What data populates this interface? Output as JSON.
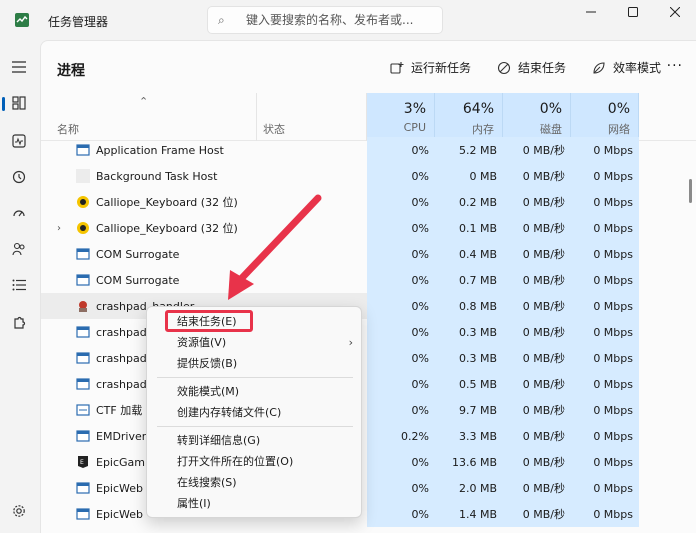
{
  "window": {
    "title": "任务管理器",
    "search_placeholder": "键入要搜索的名称、发布者或..."
  },
  "page": {
    "title": "进程",
    "toolbar": {
      "run_new_task": "运行新任务",
      "end_task": "结束任务",
      "efficiency_mode": "效率模式",
      "more": "···"
    }
  },
  "columns": {
    "name": "名称",
    "status": "状态",
    "cpu": {
      "pct": "3%",
      "label": "CPU"
    },
    "memory": {
      "pct": "64%",
      "label": "内存"
    },
    "disk": {
      "pct": "0%",
      "label": "磁盘"
    },
    "network": {
      "pct": "0%",
      "label": "网络"
    }
  },
  "processes": [
    {
      "name": "Application Frame Host",
      "cpu": "0%",
      "mem": "5.2 MB",
      "disk": "0 MB/秒",
      "net": "0 Mbps"
    },
    {
      "name": "Background Task Host",
      "cpu": "0%",
      "mem": "0 MB",
      "disk": "0 MB/秒",
      "net": "0 Mbps"
    },
    {
      "name": "Calliope_Keyboard (32 位)",
      "cpu": "0%",
      "mem": "0.2 MB",
      "disk": "0 MB/秒",
      "net": "0 Mbps"
    },
    {
      "name": "Calliope_Keyboard (32 位)",
      "cpu": "0%",
      "mem": "0.1 MB",
      "disk": "0 MB/秒",
      "net": "0 Mbps"
    },
    {
      "name": "COM Surrogate",
      "cpu": "0%",
      "mem": "0.4 MB",
      "disk": "0 MB/秒",
      "net": "0 Mbps"
    },
    {
      "name": "COM Surrogate",
      "cpu": "0%",
      "mem": "0.7 MB",
      "disk": "0 MB/秒",
      "net": "0 Mbps"
    },
    {
      "name": "crashpad_handler",
      "cpu": "0%",
      "mem": "0.8 MB",
      "disk": "0 MB/秒",
      "net": "0 Mbps"
    },
    {
      "name": "crashpad",
      "cpu": "0%",
      "mem": "0.3 MB",
      "disk": "0 MB/秒",
      "net": "0 Mbps"
    },
    {
      "name": "crashpad",
      "cpu": "0%",
      "mem": "0.3 MB",
      "disk": "0 MB/秒",
      "net": "0 Mbps"
    },
    {
      "name": "crashpad",
      "cpu": "0%",
      "mem": "0.5 MB",
      "disk": "0 MB/秒",
      "net": "0 Mbps"
    },
    {
      "name": "CTF 加载",
      "cpu": "0%",
      "mem": "9.7 MB",
      "disk": "0 MB/秒",
      "net": "0 Mbps"
    },
    {
      "name": "EMDriver",
      "cpu": "0.2%",
      "mem": "3.3 MB",
      "disk": "0 MB/秒",
      "net": "0 Mbps"
    },
    {
      "name": "EpicGam",
      "cpu": "0%",
      "mem": "13.6 MB",
      "disk": "0 MB/秒",
      "net": "0 Mbps"
    },
    {
      "name": "EpicWeb",
      "cpu": "0%",
      "mem": "2.0 MB",
      "disk": "0 MB/秒",
      "net": "0 Mbps"
    },
    {
      "name": "EpicWeb",
      "cpu": "0%",
      "mem": "1.4 MB",
      "disk": "0 MB/秒",
      "net": "0 Mbps"
    }
  ],
  "context_menu": {
    "end_task": "结束任务(E)",
    "resource_values": "资源值(V)",
    "feedback": "提供反馈(B)",
    "efficiency_mode": "效能模式(M)",
    "create_dump": "创建内存转储文件(C)",
    "go_to_details": "转到详细信息(G)",
    "open_file_location": "打开文件所在的位置(O)",
    "search_online": "在线搜索(S)",
    "properties": "属性(I)"
  },
  "colors": {
    "accent": "#005fb8",
    "heat_column": "#d6ebff",
    "annotation": "#e8334a"
  }
}
